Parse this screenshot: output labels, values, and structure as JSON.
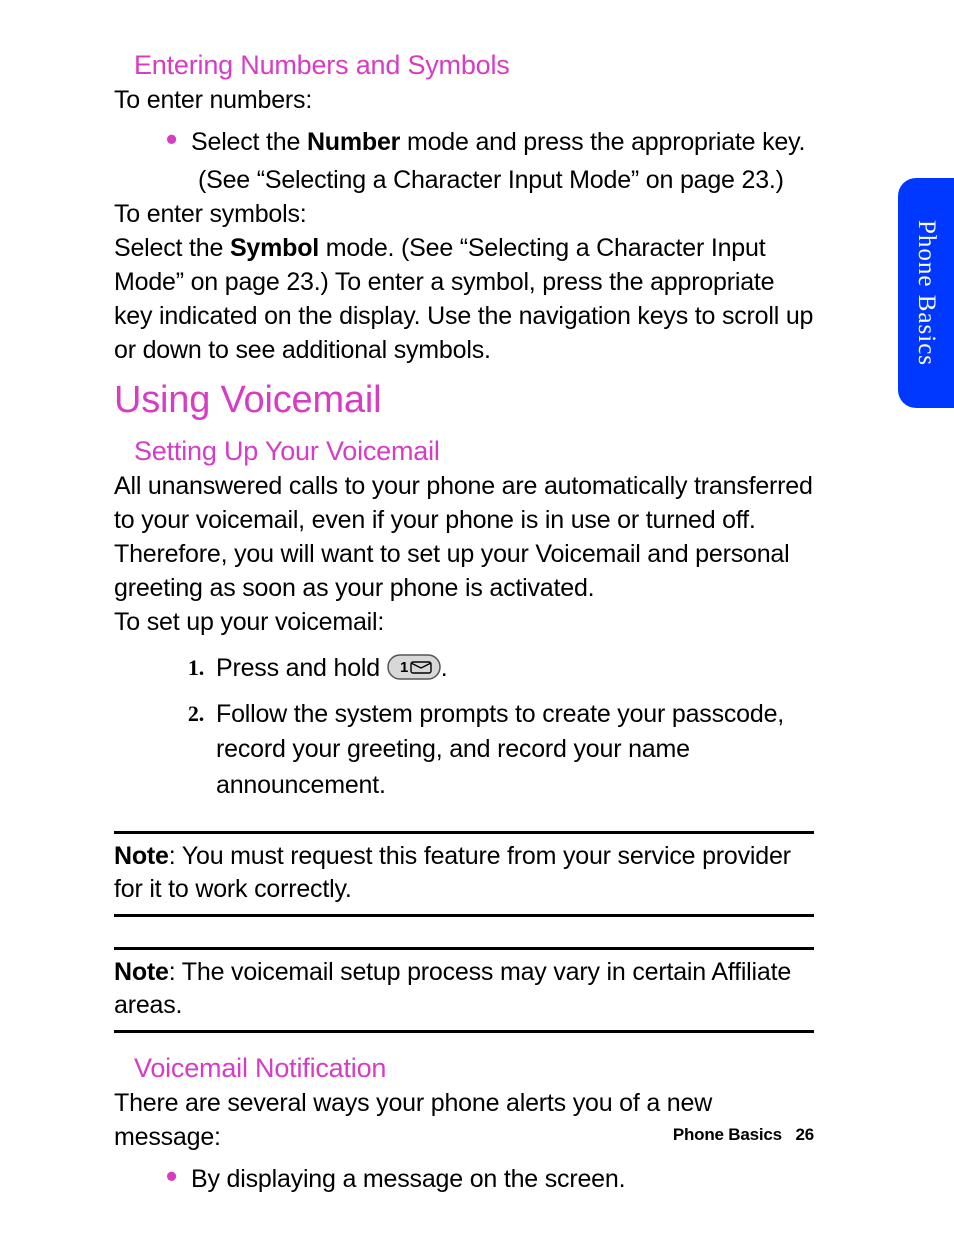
{
  "side_tab": "Phone Basics",
  "sections": {
    "entering": {
      "heading": "Entering Numbers and Symbols",
      "intro_numbers": "To enter numbers:",
      "bullet_pre": "Select the ",
      "bullet_bold": "Number",
      "bullet_post": " mode and press the appropriate key.",
      "bullet_sub": "(See “Selecting a Character Input Mode” on page 23.)",
      "intro_symbols": "To enter symbols:",
      "sym_pre": "Select the ",
      "sym_bold": "Symbol",
      "sym_post": " mode. (See “Selecting a Character Input Mode” on page 23.) To enter a symbol, press the appropriate key indicated on the display. Use the navigation keys to scroll up or down to see additional symbols."
    },
    "voicemail": {
      "heading": "Using Voicemail",
      "setup_heading": "Setting Up Your Voicemail",
      "setup_body": "All unanswered calls to your phone are automatically transferred to your voicemail, even if your phone is in use or turned off. Therefore, you will want to set up your Voicemail and personal greeting as soon as your phone is activated.",
      "setup_intro": "To set up your voicemail:",
      "steps": {
        "s1_num": "1.",
        "s1_pre": "Press and hold ",
        "s1_post": ".",
        "s2_num": "2.",
        "s2_text": "Follow the system prompts to create your passcode, record your greeting, and record your name announcement."
      },
      "note1_label": "Note",
      "note1_text": ": You must request this feature from your service provider for it to work correctly.",
      "note2_label": "Note",
      "note2_text": ": The voicemail setup process may vary in certain Affiliate areas.",
      "notif_heading": "Voicemail Notification",
      "notif_body": "There are several ways your phone alerts you of a new message:",
      "notif_bullet": "By displaying a message on the screen."
    }
  },
  "footer": {
    "section": "Phone Basics",
    "page": "26"
  }
}
